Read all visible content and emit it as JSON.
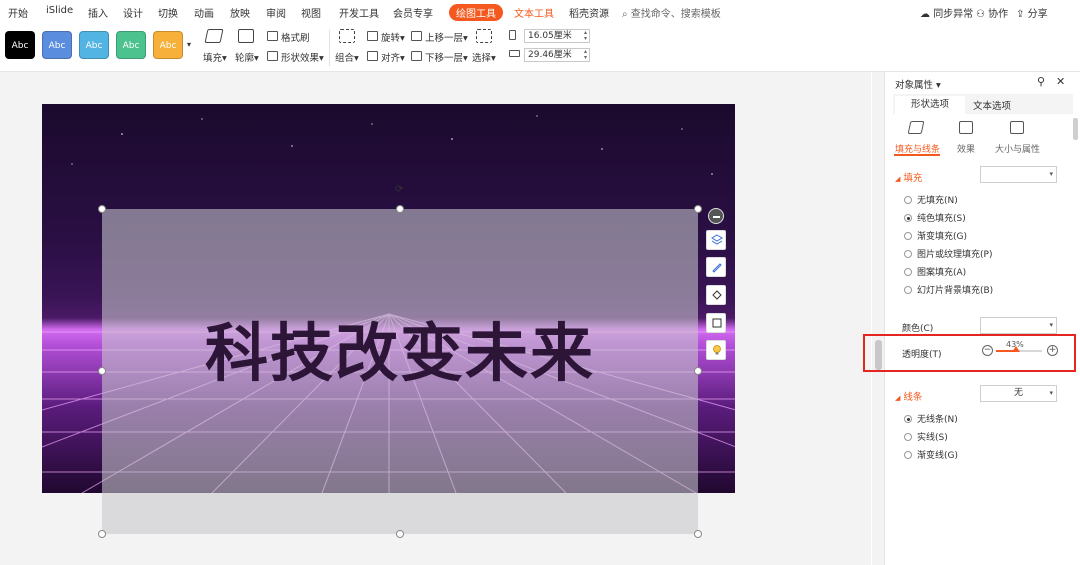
{
  "menu": {
    "items": [
      "开始",
      "iSlide",
      "插入",
      "设计",
      "切换",
      "动画",
      "放映",
      "审阅",
      "视图",
      "开发工具",
      "会员专享",
      "绘图工具",
      "文本工具",
      "稻壳资源"
    ],
    "search_placeholder": "查找命令、搜索模板",
    "sync": "同步异常",
    "collab": "协作",
    "share": "分享"
  },
  "ribbon": {
    "styles": [
      {
        "label": "Abc",
        "color": "#000000"
      },
      {
        "label": "Abc",
        "color": "#5b8dde"
      },
      {
        "label": "Abc",
        "color": "#52b4e2"
      },
      {
        "label": "Abc",
        "color": "#4cc28e"
      },
      {
        "label": "Abc",
        "color": "#f7b13a"
      }
    ],
    "fill": "填充",
    "outline": "轮廓",
    "format_painter": "格式刷",
    "shape_effect": "形状效果",
    "group": "组合",
    "rotate": "旋转",
    "align": "对齐",
    "bring_forward": "上移一层",
    "send_backward": "下移一层",
    "select": "选择",
    "height_value": "16.05厘米",
    "width_value": "29.46厘米"
  },
  "slide": {
    "title": "科技改变未来"
  },
  "panel": {
    "header": "对象属性",
    "tabs": [
      "形状选项",
      "文本选项"
    ],
    "subtabs": [
      "填充与线条",
      "效果",
      "大小与属性"
    ],
    "fill_section": "填充",
    "fill_options": [
      "无填充(N)",
      "纯色填充(S)",
      "渐变填充(G)",
      "图片或纹理填充(P)",
      "图案填充(A)",
      "幻灯片背景填充(B)"
    ],
    "fill_checked_index": 1,
    "color_label": "颜色(C)",
    "transparency_label": "透明度(T)",
    "transparency_value": "43%",
    "transparency_fraction": 0.43,
    "line_section": "线条",
    "line_dropdown": "无",
    "line_options": [
      "无线条(N)",
      "实线(S)",
      "渐变线(G)"
    ],
    "line_checked_index": 0
  },
  "colors": {
    "accent": "#f5591f",
    "highlight": "#e3261f"
  }
}
